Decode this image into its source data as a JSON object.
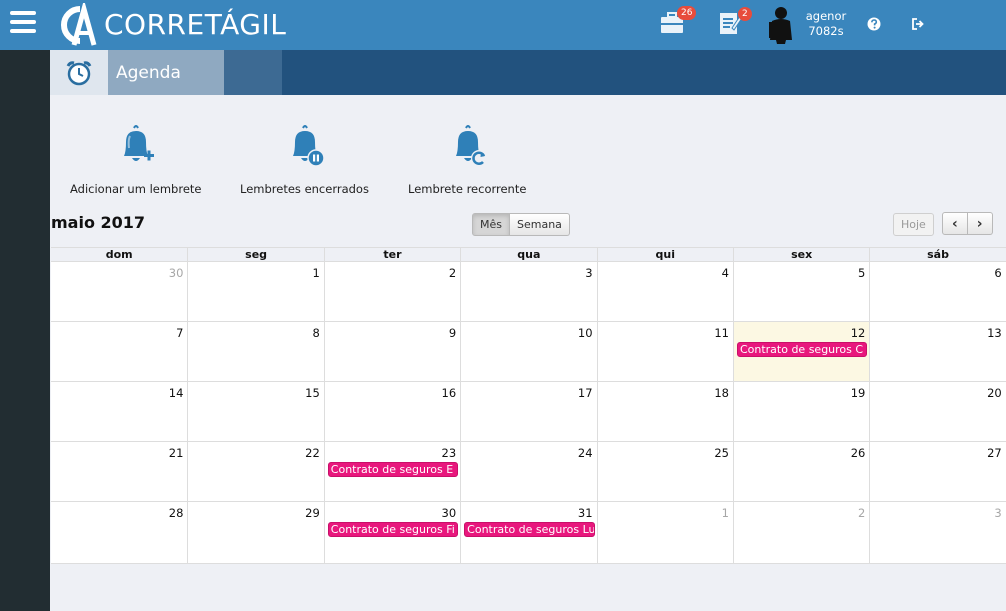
{
  "header": {
    "brand": "CORRETÁGIL",
    "badges": {
      "briefcase": "26",
      "notes": "2"
    },
    "user": {
      "line1": "agenor",
      "line2": "7082s"
    }
  },
  "module": {
    "title": "Agenda"
  },
  "actions": [
    {
      "label": "Adicionar um lembrete",
      "icon": "bell-plus-icon"
    },
    {
      "label": "Lembretes encerrados",
      "icon": "bell-pause-icon"
    },
    {
      "label": "Lembrete recorrente",
      "icon": "bell-refresh-icon"
    }
  ],
  "calendar": {
    "title": "maio 2017",
    "view_buttons": {
      "month": "Mês",
      "week": "Semana"
    },
    "today_button": "Hoje",
    "prev_label": "‹",
    "next_label": "›",
    "weekdays": [
      "dom",
      "seg",
      "ter",
      "qua",
      "qui",
      "sex",
      "sáb"
    ],
    "weeks": [
      {
        "days": [
          {
            "n": "30",
            "other": true
          },
          {
            "n": "1"
          },
          {
            "n": "2"
          },
          {
            "n": "3"
          },
          {
            "n": "4"
          },
          {
            "n": "5"
          },
          {
            "n": "6"
          }
        ]
      },
      {
        "days": [
          {
            "n": "7"
          },
          {
            "n": "8"
          },
          {
            "n": "9"
          },
          {
            "n": "10"
          },
          {
            "n": "11"
          },
          {
            "n": "12",
            "today": true,
            "event": "Contrato de seguros C"
          },
          {
            "n": "13"
          }
        ]
      },
      {
        "days": [
          {
            "n": "14"
          },
          {
            "n": "15"
          },
          {
            "n": "16"
          },
          {
            "n": "17"
          },
          {
            "n": "18"
          },
          {
            "n": "19"
          },
          {
            "n": "20"
          }
        ]
      },
      {
        "days": [
          {
            "n": "21"
          },
          {
            "n": "22"
          },
          {
            "n": "23",
            "event": "Contrato de seguros E"
          },
          {
            "n": "24"
          },
          {
            "n": "25"
          },
          {
            "n": "26"
          },
          {
            "n": "27"
          }
        ]
      },
      {
        "days": [
          {
            "n": "28"
          },
          {
            "n": "29"
          },
          {
            "n": "30",
            "event": "Contrato de seguros Fi"
          },
          {
            "n": "31",
            "event": "Contrato de seguros Lu"
          },
          {
            "n": "1",
            "other": true
          },
          {
            "n": "2",
            "other": true
          },
          {
            "n": "3",
            "other": true
          }
        ]
      }
    ]
  },
  "colors": {
    "header": "#3a86bd",
    "sidebar": "#222d32",
    "module_bar": "#22527e",
    "event": "#e8177d",
    "today": "#fcf8e3",
    "icon_blue": "#2f80b8"
  }
}
